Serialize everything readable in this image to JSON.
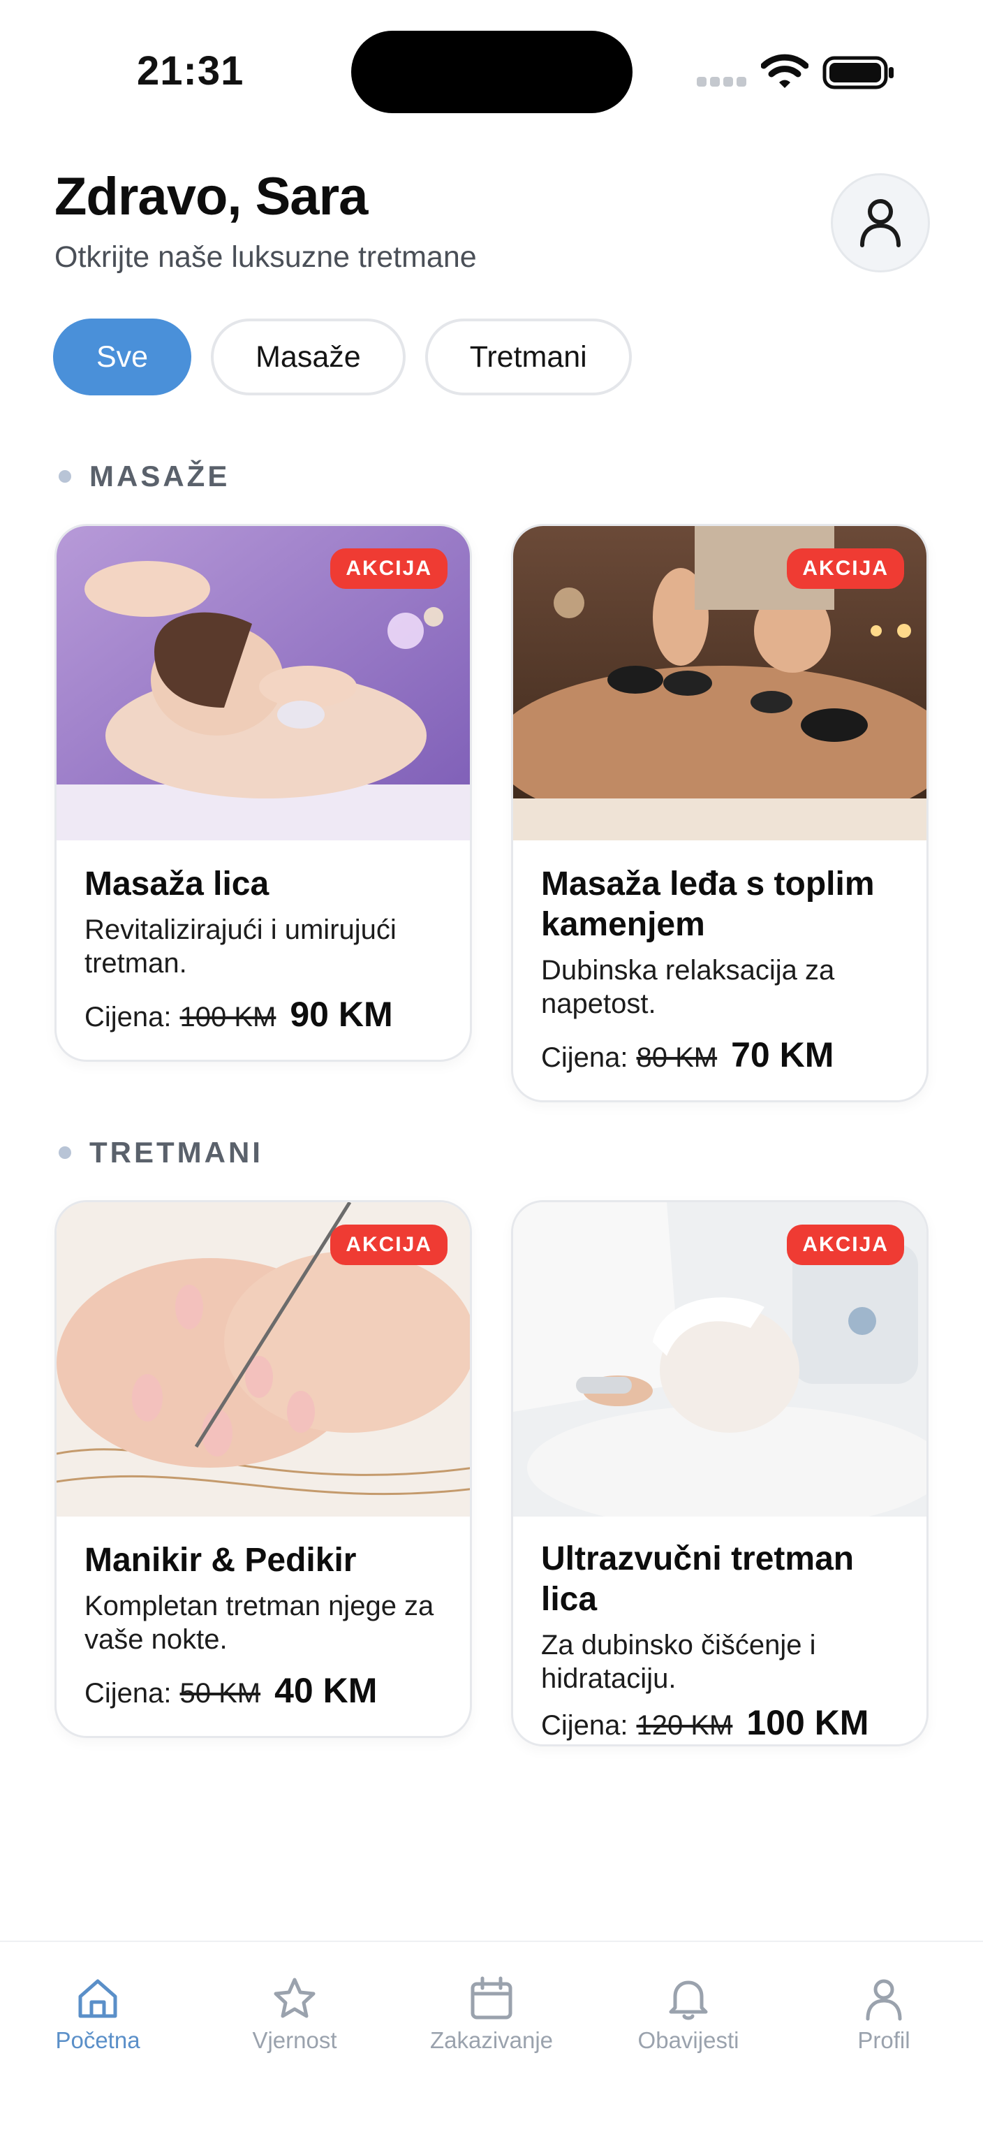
{
  "status_bar": {
    "time": "21:31"
  },
  "header": {
    "greeting": "Zdravo, Sara",
    "subtitle": "Otkrijte naše luksuzne tretmane"
  },
  "filters": [
    {
      "label": "Sve",
      "active": true
    },
    {
      "label": "Masaže",
      "active": false
    },
    {
      "label": "Tretmani",
      "active": false
    }
  ],
  "sections": [
    {
      "title": "MASAŽE",
      "cards": [
        {
          "badge": "AKCIJA",
          "title": "Masaža lica",
          "description": "Revitalizirajući i umirujući tretman.",
          "price_label": "Cijena:",
          "old_price": "100 KM",
          "new_price": "90 KM"
        },
        {
          "badge": "AKCIJA",
          "title": "Masaža leđa s toplim kamenjem",
          "description": "Dubinska relaksacija za napetost.",
          "price_label": "Cijena:",
          "old_price": "80 KM",
          "new_price": "70 KM"
        }
      ]
    },
    {
      "title": "TRETMANI",
      "cards": [
        {
          "badge": "AKCIJA",
          "title": "Manikir & Pedikir",
          "description": "Kompletan tretman njege za vaše nokte.",
          "price_label": "Cijena:",
          "old_price": "50 KM",
          "new_price": "40 KM"
        },
        {
          "badge": "AKCIJA",
          "title": "Ultrazvučni tretman lica",
          "description": "Za dubinsko čišćenje i hidrataciju.",
          "price_label": "Cijena:",
          "old_price": "120 KM",
          "new_price": "100 KM"
        }
      ]
    }
  ],
  "bottom_nav": [
    {
      "label": "Početna",
      "icon": "home-icon",
      "active": true
    },
    {
      "label": "Vjernost",
      "icon": "star-icon",
      "active": false
    },
    {
      "label": "Zakazivanje",
      "icon": "calendar-icon",
      "active": false
    },
    {
      "label": "Obavijesti",
      "icon": "bell-icon",
      "active": false
    },
    {
      "label": "Profil",
      "icon": "user-icon",
      "active": false
    }
  ],
  "colors": {
    "accent": "#4a90d9",
    "badge": "#ef3b33",
    "nav_active": "#5a8fc8",
    "nav_inactive": "#9aa2ad"
  }
}
